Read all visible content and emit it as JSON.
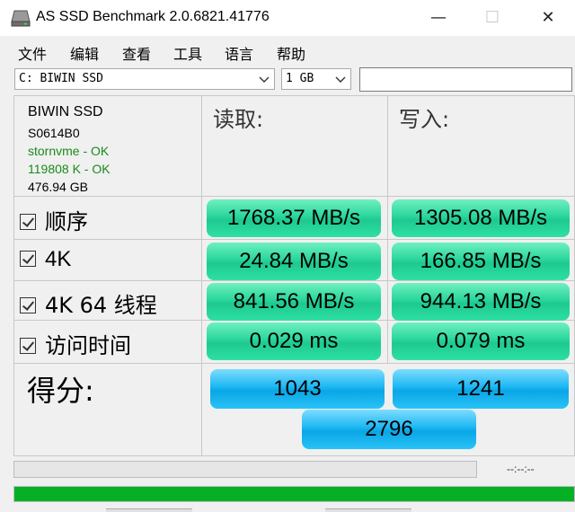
{
  "window": {
    "title": "AS SSD Benchmark 2.0.6821.41776",
    "minimize_glyph": "—",
    "maximize_glyph": "☐",
    "close_glyph": "✕"
  },
  "menu": [
    "文件",
    "编辑",
    "查看",
    "工具",
    "语言",
    "帮助"
  ],
  "toolbar": {
    "drive_value": "C: BIWIN SSD",
    "size_value": "1 GB",
    "text_value": ""
  },
  "info": {
    "name": "BIWIN SSD",
    "firmware": "S0614B0",
    "driver": "stornvme - OK",
    "alignment": "119808 K - OK",
    "capacity": "476.94 GB"
  },
  "columns": {
    "read": "读取:",
    "write": "写入:"
  },
  "rows": [
    {
      "label": "顺序",
      "read": "1768.37 MB/s",
      "write": "1305.08 MB/s"
    },
    {
      "label": "4K",
      "read": "24.84 MB/s",
      "write": "166.85 MB/s"
    },
    {
      "label": "4K 64 线程",
      "read": "841.56 MB/s",
      "write": "944.13 MB/s"
    },
    {
      "label": "访问时间",
      "read": "0.029 ms",
      "write": "0.079 ms"
    }
  ],
  "score": {
    "label": "得分:",
    "read": "1043",
    "write": "1241",
    "total": "2796"
  },
  "status": {
    "time": "--:--:--",
    "progress_percent": 100
  },
  "colors": {
    "result_green": "#2ad69c",
    "score_blue": "#1cb7f2",
    "progress_green": "#06b025"
  },
  "icons": {
    "app": "disk-drive-icon",
    "dropdown": "chevron-down-icon",
    "checkbox": "checkmark-icon"
  }
}
